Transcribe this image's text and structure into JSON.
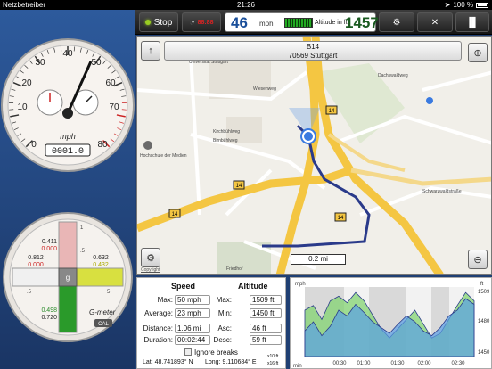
{
  "status": {
    "carrier": "Netzbetreiber",
    "time": "21:26",
    "battery": "100 %"
  },
  "toolbar": {
    "stop_label": "Stop",
    "speed_value": "46",
    "speed_unit": "mph",
    "altitude_label": "Altitude in ft",
    "altitude_value": "1457",
    "gauge_mini": "88:88",
    "icons": [
      "gears-icon",
      "tools-icon",
      "bars-icon"
    ]
  },
  "speedometer": {
    "ticks": [
      "0",
      "10",
      "20",
      "30",
      "40",
      "50",
      "60",
      "70",
      "80"
    ],
    "unit": "mph",
    "odometer": "0001.0"
  },
  "gmeter": {
    "label": "G-meter",
    "cal": "CAL",
    "top_a": "0.411",
    "top_b": "0.000",
    "left_a": "0.812",
    "left_b": "0.000",
    "right_a": "0.632",
    "right_b": "0.432",
    "bottom_a": "0.498",
    "bottom_b": "0.720",
    "center": "g",
    "scale_1": "1",
    "scale_half": ".5",
    "scale_5": "5"
  },
  "map": {
    "road": "B14",
    "address": "70569 Stuttgart",
    "scale": "0.2 mi",
    "legal": "Copyright",
    "labels": {
      "university": "Universität Stuttgart",
      "shield1": "14",
      "shield2": "14",
      "shield3": "14",
      "shield4": "14",
      "street1": "Wiesenweg",
      "street2": "Dachswaldweg",
      "street3": "Kirchbühlweg",
      "street4": "Birnbühlweg",
      "street5": "Hochschule der Medien",
      "street6": "Schwarzwaldstraße",
      "street7": "Friedhof"
    }
  },
  "stats": {
    "speed_header": "Speed",
    "altitude_header": "Altitude",
    "max_label": "Max:",
    "max_speed": "50 mph",
    "avg_label": "Average:",
    "avg_speed": "23 mph",
    "dist_label": "Distance:",
    "dist": "1.06 mi",
    "dur_label": "Duration:",
    "dur": "00:02:44",
    "alt_max_label": "Max:",
    "alt_max": "1509 ft",
    "alt_min_label": "Min:",
    "alt_min": "1450 ft",
    "asc_label": "Asc:",
    "asc": "46 ft",
    "desc_label": "Desc:",
    "desc": "59 ft",
    "ignore_breaks": "Ignore breaks",
    "lat": "Lat: 48.741893° N",
    "long": "Long: 9.110684° E",
    "x10": "x10 ft",
    "x16": "x16 ft"
  },
  "chart_data": {
    "type": "area",
    "title": "",
    "xlabel": "min",
    "ylabel_left": "mph",
    "ylabel_right": "ft",
    "x": [
      "00:30",
      "01:00",
      "01:30",
      "02:00",
      "02:30"
    ],
    "y_right_ticks": [
      "1509",
      "1480",
      "1450"
    ],
    "series": [
      {
        "color": "#5aa0e6",
        "values": [
          22,
          30,
          18,
          26,
          40,
          35,
          45,
          38,
          30,
          25,
          20,
          28,
          35,
          30,
          22,
          18,
          25,
          35,
          40,
          50,
          45
        ]
      },
      {
        "color": "#7cd36a",
        "values": [
          1490,
          1495,
          1480,
          1500,
          1505,
          1498,
          1509,
          1500,
          1485,
          1470,
          1460,
          1470,
          1480,
          1490,
          1475,
          1460,
          1465,
          1480,
          1495,
          1509,
          1500
        ]
      }
    ]
  }
}
